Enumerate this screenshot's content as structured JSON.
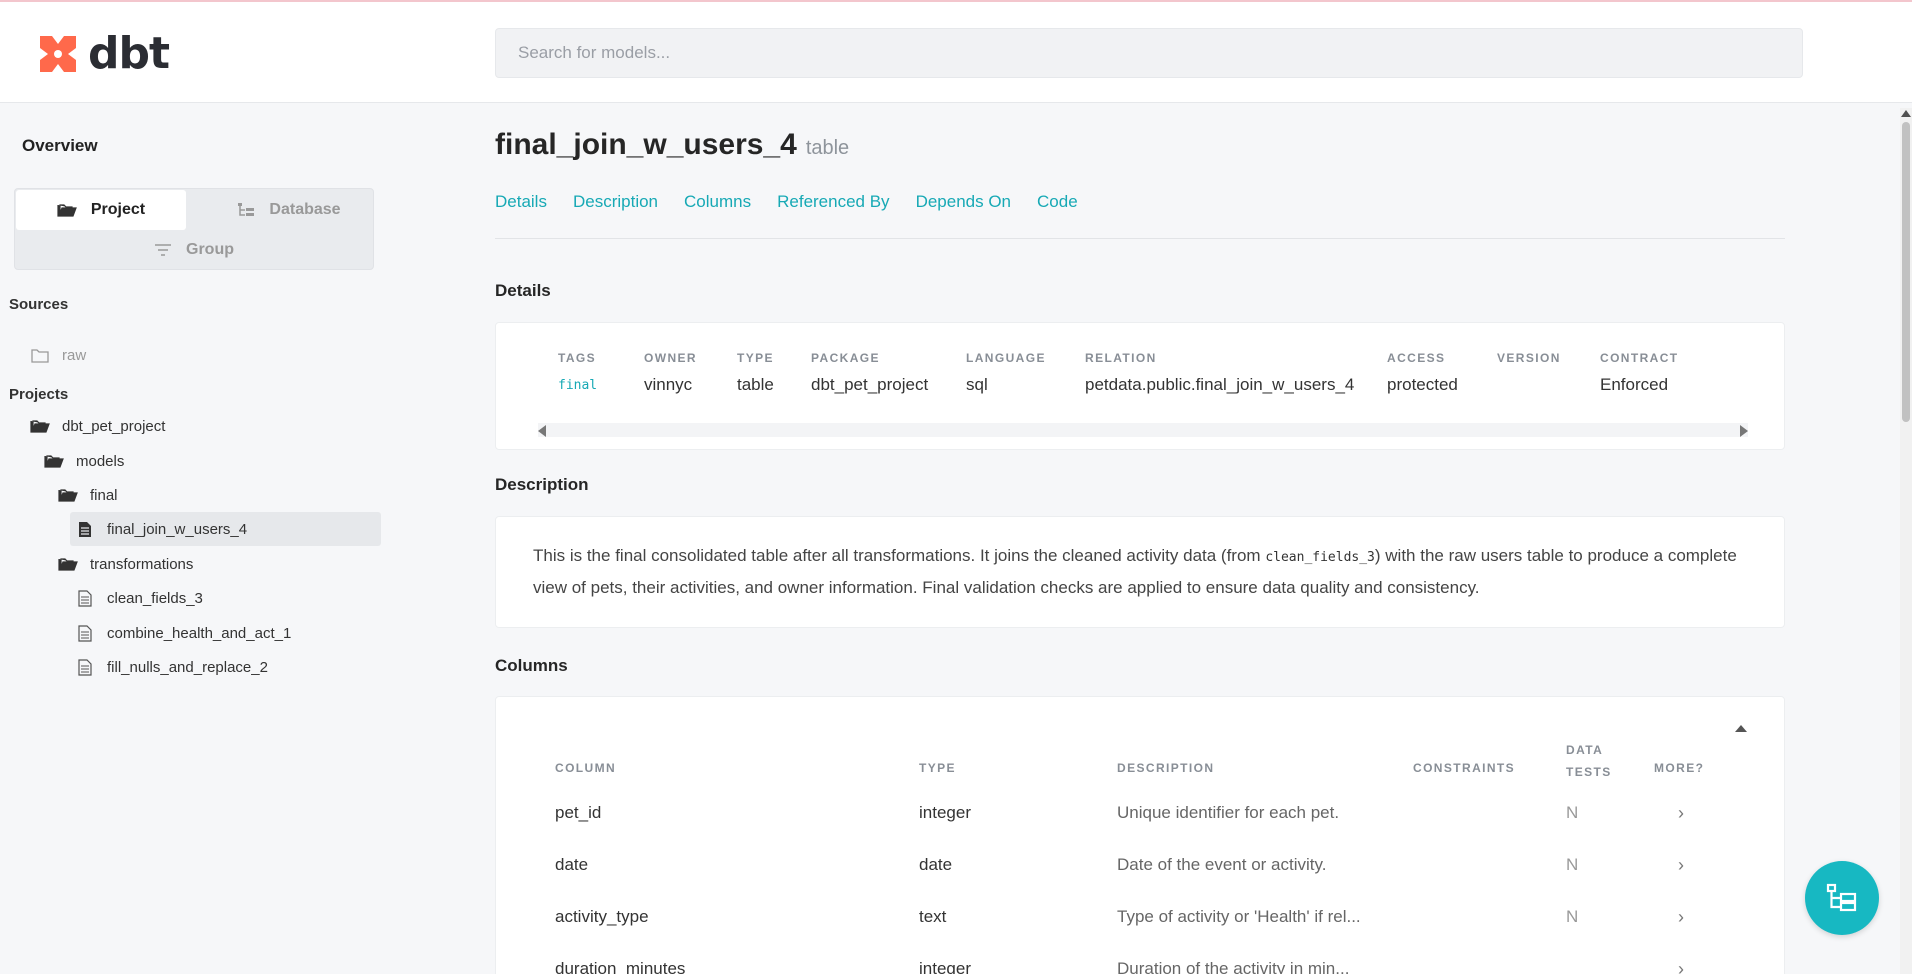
{
  "header": {
    "logo_text": "dbt",
    "search_placeholder": "Search for models..."
  },
  "sidebar": {
    "overview": "Overview",
    "tabs": {
      "project": "Project",
      "database": "Database",
      "group": "Group"
    },
    "sources_title": "Sources",
    "sources": [
      {
        "label": "raw"
      }
    ],
    "projects_title": "Projects",
    "tree": [
      {
        "label": "dbt_pet_project",
        "icon": "folder-open-icon"
      },
      {
        "label": "models",
        "icon": "folder-open-icon"
      },
      {
        "label": "final",
        "icon": "folder-open-icon"
      },
      {
        "label": "final_join_w_users_4",
        "icon": "file-icon",
        "selected": true
      },
      {
        "label": "transformations",
        "icon": "folder-open-icon"
      },
      {
        "label": "clean_fields_3",
        "icon": "file-icon"
      },
      {
        "label": "combine_health_and_act_1",
        "icon": "file-icon"
      },
      {
        "label": "fill_nulls_and_replace_2",
        "icon": "file-icon"
      }
    ]
  },
  "model": {
    "name": "final_join_w_users_4",
    "materialization": "table",
    "tabs": [
      "Details",
      "Description",
      "Columns",
      "Referenced By",
      "Depends On",
      "Code"
    ]
  },
  "details": {
    "title": "Details",
    "fields": [
      {
        "label": "TAGS",
        "value": "final"
      },
      {
        "label": "OWNER",
        "value": "vinnyc"
      },
      {
        "label": "TYPE",
        "value": "table"
      },
      {
        "label": "PACKAGE",
        "value": "dbt_pet_project"
      },
      {
        "label": "LANGUAGE",
        "value": "sql"
      },
      {
        "label": "RELATION",
        "value": "petdata.public.final_join_w_users_4"
      },
      {
        "label": "ACCESS",
        "value": "protected"
      },
      {
        "label": "VERSION",
        "value": ""
      },
      {
        "label": "CONTRACT",
        "value": "Enforced"
      }
    ]
  },
  "description": {
    "title": "Description",
    "text_before": "This is the final consolidated table after all transformations. It joins the cleaned activity data (from ",
    "code": "clean_fields_3",
    "text_after": ") with the raw users table to produce a complete view of pets, their activities, and owner information. Final validation checks are applied to ensure data quality and consistency."
  },
  "columns": {
    "title": "Columns",
    "headers": {
      "column": "COLUMN",
      "type": "TYPE",
      "description": "DESCRIPTION",
      "constraints": "CONSTRAINTS",
      "data_tests_1": "DATA",
      "data_tests_2": "TESTS",
      "more": "MORE?"
    },
    "rows": [
      {
        "name": "pet_id",
        "type": "integer",
        "description": "Unique identifier for each pet.",
        "constraints": "",
        "tests": "N",
        "more": "›"
      },
      {
        "name": "date",
        "type": "date",
        "description": "Date of the event or activity.",
        "constraints": "",
        "tests": "N",
        "more": "›"
      },
      {
        "name": "activity_type",
        "type": "text",
        "description": "Type of activity or 'Health' if rel...",
        "constraints": "",
        "tests": "N",
        "more": "›"
      },
      {
        "name": "duration_minutes",
        "type": "integer",
        "description": "Duration of the activity in min...",
        "constraints": "",
        "tests": "",
        "more": "›"
      }
    ]
  },
  "colors": {
    "accent": "#17a9b5",
    "logo": "#ff694b",
    "fab": "#17b8c2"
  }
}
